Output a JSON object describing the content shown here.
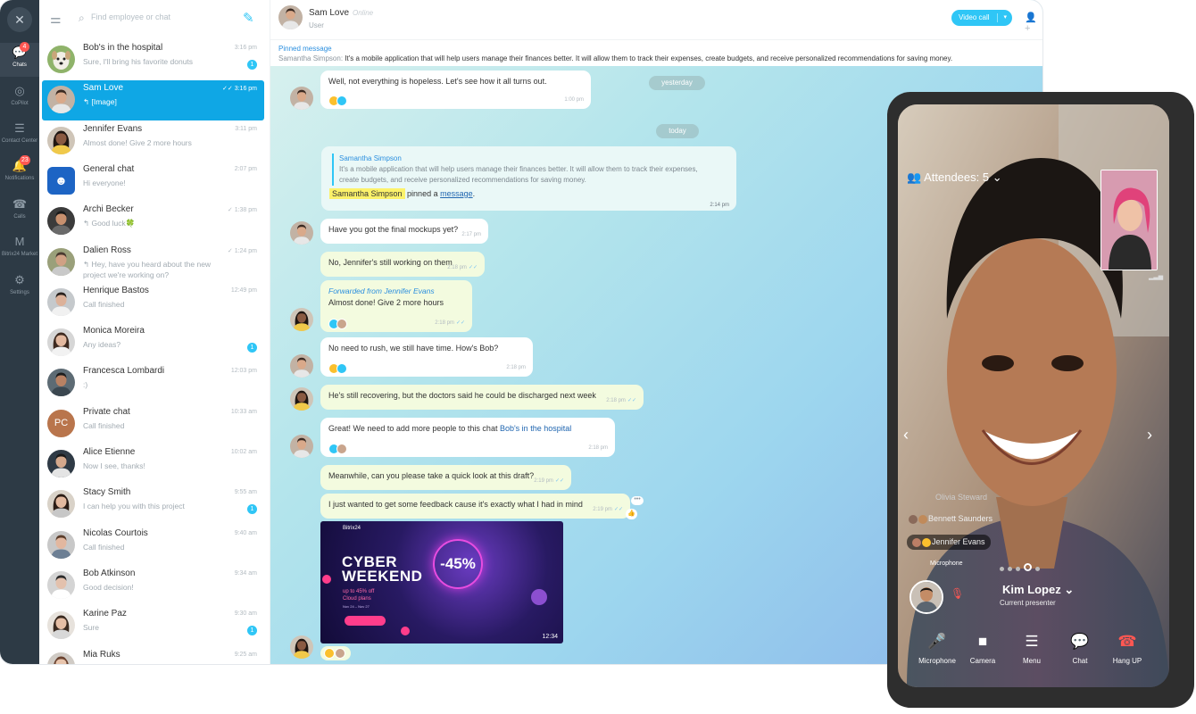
{
  "rail": {
    "close": "✕",
    "items": [
      {
        "icon": "💬",
        "label": "Chats",
        "badge": "4"
      },
      {
        "icon": "◎",
        "label": "CoPilot",
        "badge": ""
      },
      {
        "icon": "☰",
        "label": "Contact Center",
        "badge": ""
      },
      {
        "icon": "🔔",
        "label": "Notifications",
        "badge": "23"
      },
      {
        "icon": "☎",
        "label": "Calls",
        "badge": ""
      },
      {
        "icon": "M",
        "label": "Bitrix24 Market",
        "badge": ""
      },
      {
        "icon": "⚙",
        "label": "Settings",
        "badge": ""
      }
    ]
  },
  "search": {
    "placeholder": "Find employee or chat"
  },
  "chats": [
    {
      "name": "Bob's in the hospital",
      "preview": "Sure, I'll bring his favorite donuts",
      "time": "3:16 pm",
      "badge": "1",
      "avatar": "dog"
    },
    {
      "name": "Sam Love",
      "preview": "↰ [Image]",
      "time": "✓✓ 3:16 pm",
      "badge": "",
      "avatar": "man1",
      "active": true
    },
    {
      "name": "Jennifer Evans",
      "preview": "Almost done! Give 2 more hours",
      "time": "3:11 pm",
      "badge": "",
      "avatar": "woman1"
    },
    {
      "name": "General chat",
      "preview": "Hi everyone!",
      "time": "2:07 pm",
      "badge": "",
      "avatar": "group"
    },
    {
      "name": "Archi Becker",
      "preview": "↰ Good luck🍀",
      "time": "✓ 1:38 pm",
      "badge": "",
      "avatar": "man2"
    },
    {
      "name": "Dalien Ross",
      "preview": "↰ Hey, have you heard about the new project we're working on?",
      "time": "✓ 1:24 pm",
      "badge": "",
      "avatar": "man3"
    },
    {
      "name": "Henrique Bastos",
      "preview": "Call finished",
      "time": "12:49 pm",
      "badge": "",
      "avatar": "man4"
    },
    {
      "name": "Monica Moreira",
      "preview": "Any ideas?",
      "time": "",
      "badge": "1",
      "avatar": "woman2"
    },
    {
      "name": "Francesca Lombardi",
      "preview": ":)",
      "time": "12:03 pm",
      "badge": "",
      "avatar": "man5"
    },
    {
      "name": "Private chat",
      "preview": "Call finished",
      "time": "10:33 am",
      "badge": "",
      "avatar": "PC"
    },
    {
      "name": "Alice Etienne",
      "preview": "Now I see, thanks!",
      "time": "10:02 am",
      "badge": "",
      "avatar": "man6"
    },
    {
      "name": "Stacy Smith",
      "preview": "I can help you with this project",
      "time": "9:55 am",
      "badge": "1",
      "avatar": "woman3"
    },
    {
      "name": "Nicolas Courtois",
      "preview": "Call finished",
      "time": "9:40 am",
      "badge": "",
      "avatar": "man7"
    },
    {
      "name": "Bob Atkinson",
      "preview": "Good decision!",
      "time": "9:34 am",
      "badge": "",
      "avatar": "man8"
    },
    {
      "name": "Karine Paz",
      "preview": "Sure",
      "time": "9:30 am",
      "badge": "1",
      "avatar": "woman4"
    },
    {
      "name": "Mia Ruks",
      "preview": "",
      "time": "9:25 am",
      "badge": "",
      "avatar": "woman5"
    }
  ],
  "header": {
    "name": "Sam Love",
    "status": "Online",
    "role": "User",
    "video_call": "Video call"
  },
  "pinned": {
    "title": "Pinned message",
    "author": "Samantha Simpson:",
    "text": "It's a mobile application that will help users manage their finances better. It will allow them to track their expenses, create budgets, and receive personalized recommendations for saving money."
  },
  "dividers": {
    "yesterday": "yesterday",
    "today": "today"
  },
  "messages": {
    "m1": {
      "text": "Well, not everything is hopeless. Let's see how it all turns out.",
      "time": "1:00 pm"
    },
    "system": {
      "quote_name": "Samantha Simpson",
      "quote_text": "It's a mobile application that will help users manage their finances better. It will allow them to track their expenses, create budgets, and receive personalized recommendations for saving money.",
      "who": "Samantha Simpson",
      "action": " pinned a ",
      "link": "message",
      "end": ".",
      "time": "2:14 pm"
    },
    "m2": {
      "text": "Have you got the final mockups yet?",
      "time": "2:17 pm"
    },
    "m3": {
      "text": "No, Jennifer's still working on them",
      "time": "2:18 pm"
    },
    "m4": {
      "fwd": "Forwarded from Jennifer Evans",
      "text": "Almost done! Give 2 more hours",
      "time": "2:18 pm"
    },
    "m5": {
      "text": "No need to rush, we still have time. How's Bob?",
      "time": "2:18 pm"
    },
    "m6": {
      "text": "He's still recovering, but the doctors said he could be discharged next week",
      "time": "2:18 pm"
    },
    "m7": {
      "text": "Great! We need to add more people to this chat ",
      "link": "Bob's in the hospital",
      "time": "2:18 pm"
    },
    "m8": {
      "text": "Meanwhile, can you please take a quick look at this draft?",
      "time": "2:19 pm"
    },
    "m9": {
      "text": "I just wanted to get some feedback cause it's exactly what I had in mind",
      "time": "2:19 pm"
    }
  },
  "promo": {
    "brand": "Bitrix24",
    "line1": "CYBER",
    "line2": "WEEKEND",
    "percent": "-45%",
    "sub1": "up to 45% off",
    "sub2": "Cloud plans",
    "dates": "Nov 24 – Nov 27",
    "duration": "12:34"
  },
  "call": {
    "attendees": "Attendees: 5",
    "participants": [
      "Olivia Steward",
      "Bennett Saunders",
      "Jennifer Evans"
    ],
    "mic_label": "Microphone",
    "presenter_name": "Kim Lopez",
    "presenter_role": "Current presenter",
    "controls": [
      {
        "icon": "🎤",
        "label": "Microphone"
      },
      {
        "icon": "■",
        "label": "Camera"
      },
      {
        "icon": "☰",
        "label": "Menu"
      },
      {
        "icon": "💬",
        "label": "Chat"
      },
      {
        "icon": "☎",
        "label": "Hang UP"
      }
    ]
  }
}
